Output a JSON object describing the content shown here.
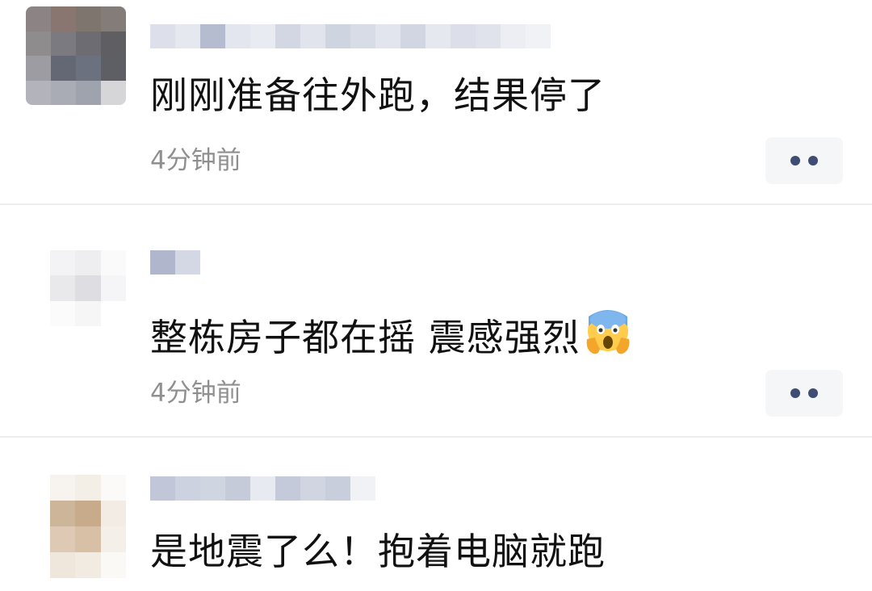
{
  "comments": [
    {
      "text": "刚刚准备往外跑，结果停了",
      "time": "4分钟前",
      "more_icon": "more-dots-icon"
    },
    {
      "text": "整栋房子都在摇 震感强烈",
      "emoji": "screaming-face-emoji",
      "time": "4分钟前",
      "more_icon": "more-dots-icon"
    },
    {
      "text": "是地震了么！抱着电脑就跑"
    }
  ],
  "colors": {
    "text": "#111111",
    "time": "#8f8f8f",
    "more_button_bg": "#f5f6f8",
    "more_dots": "#3e4d73",
    "divider": "#ececec"
  }
}
